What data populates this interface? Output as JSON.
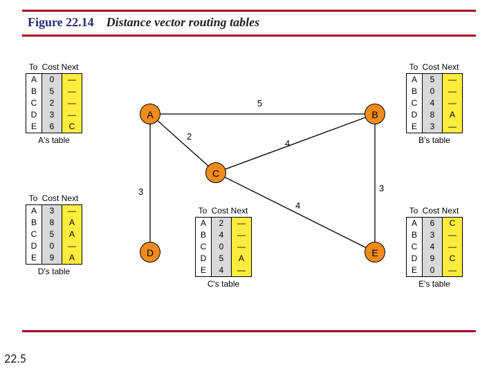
{
  "figure": {
    "label": "Figure 22.14",
    "caption": "Distance vector routing tables"
  },
  "slide_number": "22.5",
  "headers": {
    "to": "To",
    "cost": "Cost",
    "next": "Next"
  },
  "nodes": {
    "A": "A",
    "B": "B",
    "C": "C",
    "D": "D",
    "E": "E"
  },
  "edges": {
    "AB": "5",
    "AC": "2",
    "AD": "3",
    "BC": "4",
    "BE": "3",
    "CE": "4"
  },
  "tables": {
    "A": {
      "caption": "A's table",
      "rows": [
        {
          "to": "A",
          "cost": "0",
          "next": "—"
        },
        {
          "to": "B",
          "cost": "5",
          "next": "—"
        },
        {
          "to": "C",
          "cost": "2",
          "next": "—"
        },
        {
          "to": "D",
          "cost": "3",
          "next": "—"
        },
        {
          "to": "E",
          "cost": "6",
          "next": "C"
        }
      ]
    },
    "B": {
      "caption": "B's table",
      "rows": [
        {
          "to": "A",
          "cost": "5",
          "next": "—"
        },
        {
          "to": "B",
          "cost": "0",
          "next": "—"
        },
        {
          "to": "C",
          "cost": "4",
          "next": "—"
        },
        {
          "to": "D",
          "cost": "8",
          "next": "A"
        },
        {
          "to": "E",
          "cost": "3",
          "next": "—"
        }
      ]
    },
    "C": {
      "caption": "C's table",
      "rows": [
        {
          "to": "A",
          "cost": "2",
          "next": "—"
        },
        {
          "to": "B",
          "cost": "4",
          "next": "—"
        },
        {
          "to": "C",
          "cost": "0",
          "next": "—"
        },
        {
          "to": "D",
          "cost": "5",
          "next": "A"
        },
        {
          "to": "E",
          "cost": "4",
          "next": "—"
        }
      ]
    },
    "D": {
      "caption": "D's table",
      "rows": [
        {
          "to": "A",
          "cost": "3",
          "next": "—"
        },
        {
          "to": "B",
          "cost": "8",
          "next": "A"
        },
        {
          "to": "C",
          "cost": "5",
          "next": "A"
        },
        {
          "to": "D",
          "cost": "0",
          "next": "—"
        },
        {
          "to": "E",
          "cost": "9",
          "next": "A"
        }
      ]
    },
    "E": {
      "caption": "E's table",
      "rows": [
        {
          "to": "A",
          "cost": "6",
          "next": "C"
        },
        {
          "to": "B",
          "cost": "3",
          "next": "—"
        },
        {
          "to": "C",
          "cost": "4",
          "next": "—"
        },
        {
          "to": "D",
          "cost": "9",
          "next": "C"
        },
        {
          "to": "E",
          "cost": "0",
          "next": "—"
        }
      ]
    }
  },
  "chart_data": {
    "type": "graph",
    "nodes": [
      "A",
      "B",
      "C",
      "D",
      "E"
    ],
    "edges": [
      {
        "u": "A",
        "v": "B",
        "w": 5
      },
      {
        "u": "A",
        "v": "C",
        "w": 2
      },
      {
        "u": "A",
        "v": "D",
        "w": 3
      },
      {
        "u": "B",
        "v": "C",
        "w": 4
      },
      {
        "u": "B",
        "v": "E",
        "w": 3
      },
      {
        "u": "C",
        "v": "E",
        "w": 4
      }
    ],
    "routing_tables": {
      "A": [
        [
          "A",
          0,
          null
        ],
        [
          "B",
          5,
          null
        ],
        [
          "C",
          2,
          null
        ],
        [
          "D",
          3,
          null
        ],
        [
          "E",
          6,
          "C"
        ]
      ],
      "B": [
        [
          "A",
          5,
          null
        ],
        [
          "B",
          0,
          null
        ],
        [
          "C",
          4,
          null
        ],
        [
          "D",
          8,
          "A"
        ],
        [
          "E",
          3,
          null
        ]
      ],
      "C": [
        [
          "A",
          2,
          null
        ],
        [
          "B",
          4,
          null
        ],
        [
          "C",
          0,
          null
        ],
        [
          "D",
          5,
          "A"
        ],
        [
          "E",
          4,
          null
        ]
      ],
      "D": [
        [
          "A",
          3,
          null
        ],
        [
          "B",
          8,
          "A"
        ],
        [
          "C",
          5,
          "A"
        ],
        [
          "D",
          0,
          null
        ],
        [
          "E",
          9,
          "A"
        ]
      ],
      "E": [
        [
          "A",
          6,
          "C"
        ],
        [
          "B",
          3,
          null
        ],
        [
          "C",
          4,
          null
        ],
        [
          "D",
          9,
          "C"
        ],
        [
          "E",
          0,
          null
        ]
      ]
    }
  }
}
